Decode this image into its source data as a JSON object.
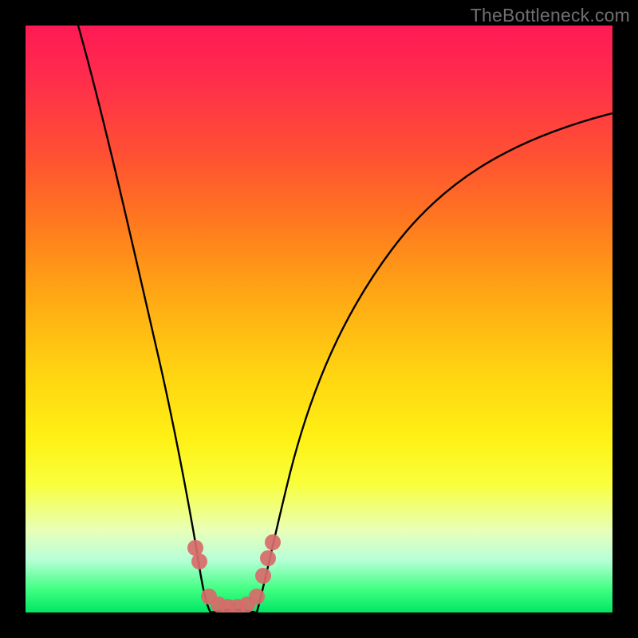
{
  "watermark": "TheBottleneck.com",
  "chart_data": {
    "type": "line",
    "title": "",
    "xlabel": "",
    "ylabel": "",
    "xlim": [
      0,
      100
    ],
    "ylim": [
      0,
      100
    ],
    "series": [
      {
        "name": "left-curve",
        "x": [
          9,
          12,
          15,
          18,
          20,
          22,
          24,
          25.5,
          27,
          28.5,
          30
        ],
        "y": [
          100,
          86,
          72,
          58,
          47,
          37,
          27,
          20,
          13,
          7,
          0
        ]
      },
      {
        "name": "right-curve",
        "x": [
          38,
          40,
          42,
          45,
          48,
          52,
          56,
          62,
          70,
          80,
          90,
          100
        ],
        "y": [
          0,
          7,
          14,
          24,
          33,
          42,
          50,
          58,
          66,
          74,
          80,
          85
        ]
      }
    ],
    "highlight_points": {
      "name": "optimal-region-markers",
      "x": [
        28.2,
        28.8,
        30.5,
        32.0,
        33.5,
        35.0,
        36.5,
        38.0,
        39.2,
        40.0,
        40.8
      ],
      "y": [
        10,
        8,
        2.5,
        1.5,
        1.2,
        1.2,
        1.5,
        2.5,
        6,
        9,
        12
      ]
    },
    "background": {
      "type": "vertical-gradient",
      "stops": [
        {
          "pos": 0.0,
          "color": "#ff1a55"
        },
        {
          "pos": 0.5,
          "color": "#ffd012"
        },
        {
          "pos": 0.85,
          "color": "#f4ffb8"
        },
        {
          "pos": 1.0,
          "color": "#00e664"
        }
      ]
    }
  }
}
